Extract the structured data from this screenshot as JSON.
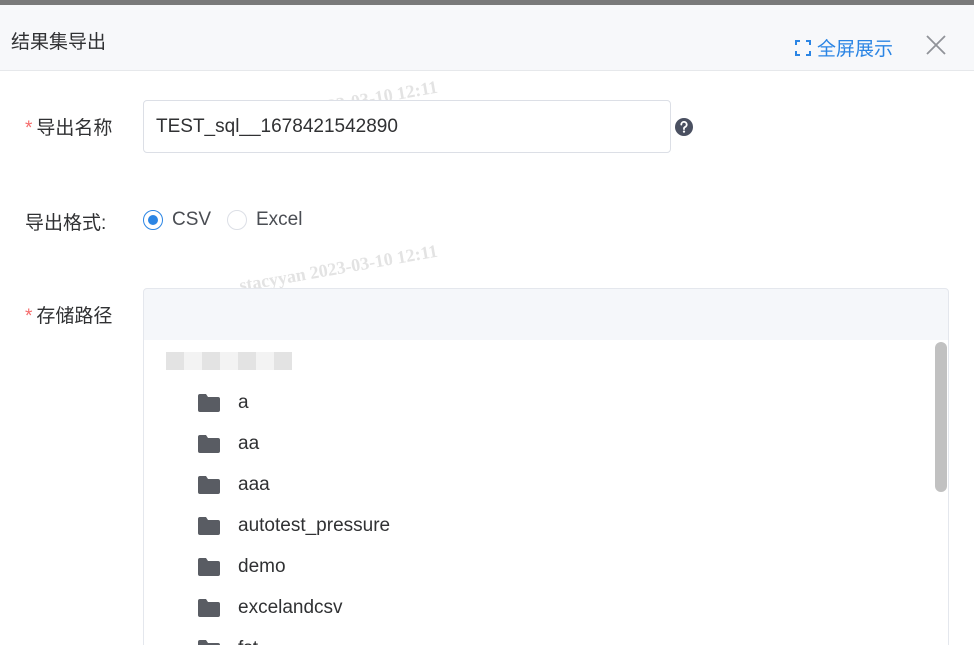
{
  "dialog": {
    "title": "结果集导出",
    "fullscreen_label": "全屏展示"
  },
  "form": {
    "required_mark": "*",
    "name_label": "导出名称",
    "name_value": "TEST_sql__1678421542890",
    "format_label": "导出格式:",
    "format_options": [
      {
        "label": "CSV",
        "checked": true
      },
      {
        "label": "Excel",
        "checked": false
      }
    ],
    "path_label": "存储路径"
  },
  "tree": {
    "folders": [
      "a",
      "aa",
      "aaa",
      "autotest_pressure",
      "demo",
      "excelandcsv",
      "fst"
    ]
  },
  "watermark": "stacyyan 2023-03-10 12:11",
  "colors": {
    "primary": "#2b85e4",
    "required": "#f56c6c"
  }
}
